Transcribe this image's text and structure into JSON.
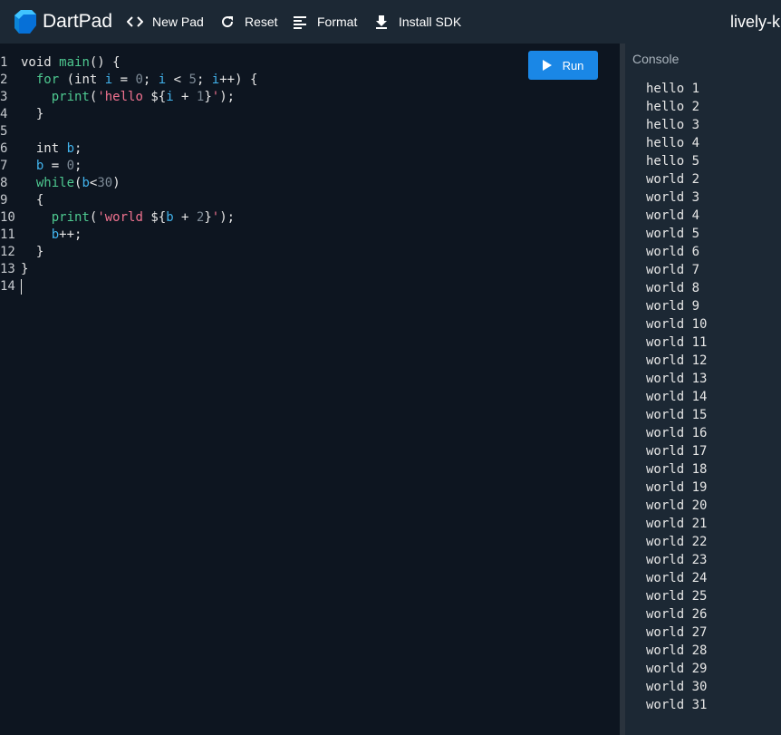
{
  "header": {
    "brand": "DartPad",
    "new_pad_label": "New Pad",
    "reset_label": "Reset",
    "format_label": "Format",
    "install_sdk_label": "Install SDK",
    "pad_name": "lively-k"
  },
  "editor": {
    "run_label": "Run",
    "lines": [
      {
        "n": "1",
        "tokens": [
          [
            "kw",
            "void "
          ],
          [
            "fn",
            "main"
          ],
          [
            "plain",
            "() {"
          ]
        ]
      },
      {
        "n": "2",
        "tokens": [
          [
            "plain",
            "  "
          ],
          [
            "fn",
            "for"
          ],
          [
            "plain",
            " (int "
          ],
          [
            "var",
            "i"
          ],
          [
            "plain",
            " = "
          ],
          [
            "num",
            "0"
          ],
          [
            "plain",
            "; "
          ],
          [
            "var",
            "i"
          ],
          [
            "plain",
            " < "
          ],
          [
            "num",
            "5"
          ],
          [
            "plain",
            "; "
          ],
          [
            "var",
            "i"
          ],
          [
            "plain",
            "++) {"
          ]
        ]
      },
      {
        "n": "3",
        "tokens": [
          [
            "plain",
            "    "
          ],
          [
            "fn",
            "print"
          ],
          [
            "plain",
            "("
          ],
          [
            "str",
            "'hello "
          ],
          [
            "plain",
            "${"
          ],
          [
            "var",
            "i"
          ],
          [
            "plain",
            " + "
          ],
          [
            "num",
            "1"
          ],
          [
            "plain",
            "}"
          ],
          [
            "str",
            "'"
          ],
          [
            "plain",
            ");"
          ]
        ]
      },
      {
        "n": "4",
        "tokens": [
          [
            "plain",
            "  }"
          ]
        ]
      },
      {
        "n": "5",
        "tokens": []
      },
      {
        "n": "6",
        "tokens": [
          [
            "plain",
            "  int "
          ],
          [
            "var",
            "b"
          ],
          [
            "plain",
            ";"
          ]
        ]
      },
      {
        "n": "7",
        "tokens": [
          [
            "plain",
            "  "
          ],
          [
            "var",
            "b"
          ],
          [
            "plain",
            " = "
          ],
          [
            "num",
            "0"
          ],
          [
            "plain",
            ";"
          ]
        ]
      },
      {
        "n": "8",
        "tokens": [
          [
            "plain",
            "  "
          ],
          [
            "fn",
            "while"
          ],
          [
            "plain",
            "("
          ],
          [
            "var",
            "b"
          ],
          [
            "plain",
            "<"
          ],
          [
            "num",
            "30"
          ],
          [
            "plain",
            ")"
          ]
        ]
      },
      {
        "n": "9",
        "tokens": [
          [
            "plain",
            "  {"
          ]
        ]
      },
      {
        "n": "10",
        "tokens": [
          [
            "plain",
            "    "
          ],
          [
            "fn",
            "print"
          ],
          [
            "plain",
            "("
          ],
          [
            "str",
            "'world "
          ],
          [
            "plain",
            "${"
          ],
          [
            "var",
            "b"
          ],
          [
            "plain",
            " + "
          ],
          [
            "num",
            "2"
          ],
          [
            "plain",
            "}"
          ],
          [
            "str",
            "'"
          ],
          [
            "plain",
            ");"
          ]
        ]
      },
      {
        "n": "11",
        "tokens": [
          [
            "plain",
            "    "
          ],
          [
            "var",
            "b"
          ],
          [
            "plain",
            "++;"
          ]
        ]
      },
      {
        "n": "12",
        "tokens": [
          [
            "plain",
            "  }"
          ]
        ]
      },
      {
        "n": "13",
        "tokens": [
          [
            "plain",
            "}"
          ]
        ]
      },
      {
        "n": "14",
        "tokens": []
      }
    ]
  },
  "console": {
    "title": "Console",
    "output": [
      "hello 1",
      "hello 2",
      "hello 3",
      "hello 4",
      "hello 5",
      "world 2",
      "world 3",
      "world 4",
      "world 5",
      "world 6",
      "world 7",
      "world 8",
      "world 9",
      "world 10",
      "world 11",
      "world 12",
      "world 13",
      "world 14",
      "world 15",
      "world 16",
      "world 17",
      "world 18",
      "world 19",
      "world 20",
      "world 21",
      "world 22",
      "world 23",
      "world 24",
      "world 25",
      "world 26",
      "world 27",
      "world 28",
      "world 29",
      "world 30",
      "world 31"
    ]
  },
  "colors": {
    "accent": "#1a87e6",
    "header_bg": "#1c2834",
    "editor_bg": "#0d1520",
    "function": "#4ec990",
    "variable": "#42b4ee",
    "string": "#f0728f",
    "number": "#7d8a96"
  },
  "icons": {
    "logo": "dart-logo-icon",
    "new_pad": "code-brackets-icon",
    "reset": "refresh-icon",
    "format": "format-align-icon",
    "install_sdk": "download-icon",
    "run": "play-icon"
  }
}
